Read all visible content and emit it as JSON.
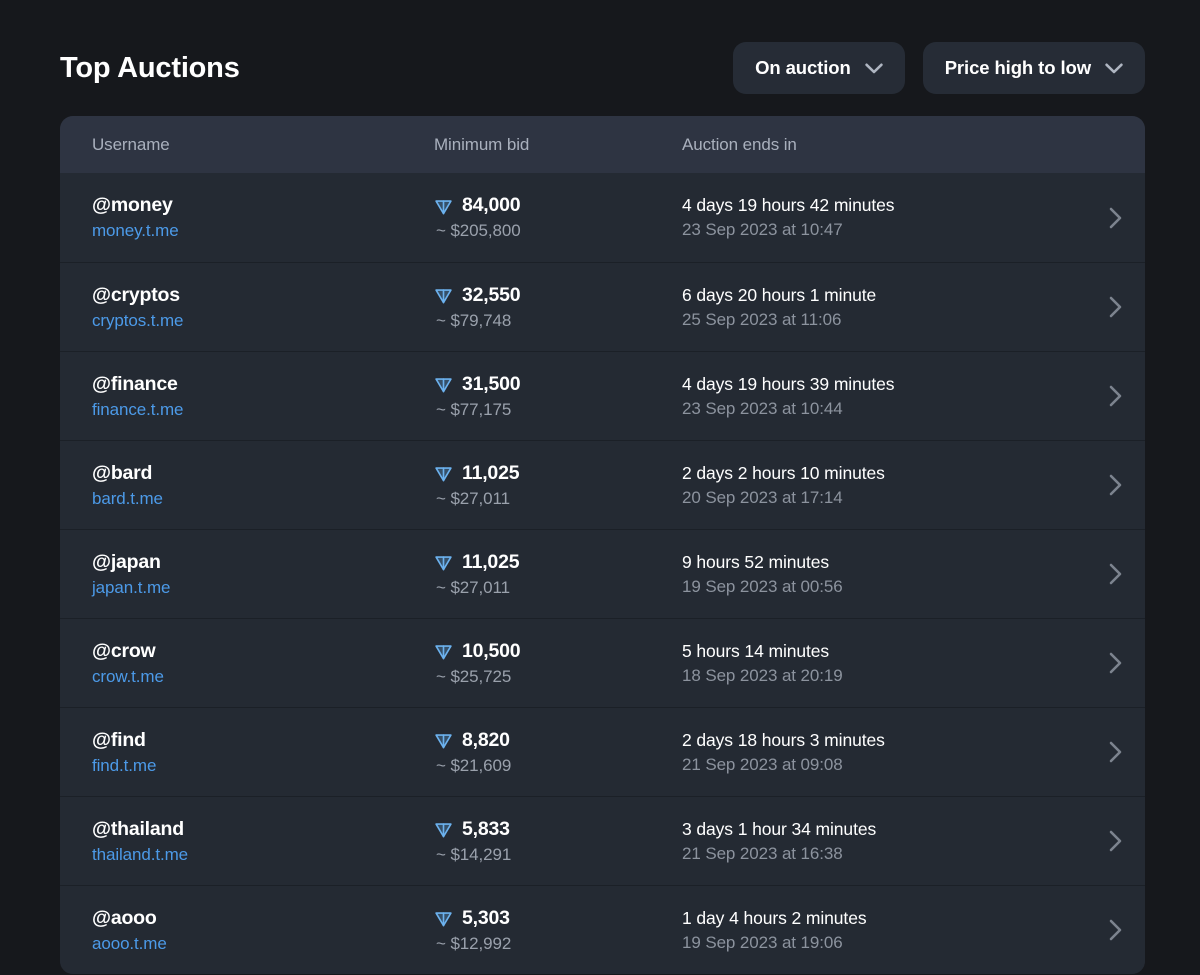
{
  "header": {
    "title": "Top Auctions",
    "filters": [
      {
        "label": "On auction",
        "icon": "chevron-down-icon"
      },
      {
        "label": "Price high to low",
        "icon": "chevron-down-icon"
      }
    ]
  },
  "table": {
    "columns": [
      "Username",
      "Minimum bid",
      "Auction ends in"
    ],
    "rows": [
      {
        "username": "@money",
        "link": "money.t.me",
        "bid": "84,000",
        "bid_usd": "~ $205,800",
        "ends_in": "4 days 19 hours 42 minutes",
        "ends_date": "23 Sep 2023 at 10:47"
      },
      {
        "username": "@cryptos",
        "link": "cryptos.t.me",
        "bid": "32,550",
        "bid_usd": "~ $79,748",
        "ends_in": "6 days 20 hours 1 minute",
        "ends_date": "25 Sep 2023 at 11:06"
      },
      {
        "username": "@finance",
        "link": "finance.t.me",
        "bid": "31,500",
        "bid_usd": "~ $77,175",
        "ends_in": "4 days 19 hours 39 minutes",
        "ends_date": "23 Sep 2023 at 10:44"
      },
      {
        "username": "@bard",
        "link": "bard.t.me",
        "bid": "11,025",
        "bid_usd": "~ $27,011",
        "ends_in": "2 days 2 hours 10 minutes",
        "ends_date": "20 Sep 2023 at 17:14"
      },
      {
        "username": "@japan",
        "link": "japan.t.me",
        "bid": "11,025",
        "bid_usd": "~ $27,011",
        "ends_in": "9 hours 52 minutes",
        "ends_date": "19 Sep 2023 at 00:56"
      },
      {
        "username": "@crow",
        "link": "crow.t.me",
        "bid": "10,500",
        "bid_usd": "~ $25,725",
        "ends_in": "5 hours 14 minutes",
        "ends_date": "18 Sep 2023 at 20:19"
      },
      {
        "username": "@find",
        "link": "find.t.me",
        "bid": "8,820",
        "bid_usd": "~ $21,609",
        "ends_in": "2 days 18 hours 3 minutes",
        "ends_date": "21 Sep 2023 at 09:08"
      },
      {
        "username": "@thailand",
        "link": "thailand.t.me",
        "bid": "5,833",
        "bid_usd": "~ $14,291",
        "ends_in": "3 days 1 hour 34 minutes",
        "ends_date": "21 Sep 2023 at 16:38"
      },
      {
        "username": "@aooo",
        "link": "aooo.t.me",
        "bid": "5,303",
        "bid_usd": "~ $12,992",
        "ends_in": "1 day 4 hours 2 minutes",
        "ends_date": "19 Sep 2023 at 19:06"
      }
    ],
    "row_icon": "ton-crystal-icon",
    "row_arrow_icon": "chevron-right-icon"
  },
  "colors": {
    "page_background": "#16181c",
    "card_background": "#242a33",
    "table_header_background": "#2e3442",
    "row_divider": "#1b2027",
    "button_background": "#262c36",
    "link_blue": "#4c9ae8",
    "ton_blue": "#5fa8e8",
    "text_primary": "#ffffff",
    "text_secondary": "#9aa1ac",
    "text_muted": "#8c939e"
  }
}
